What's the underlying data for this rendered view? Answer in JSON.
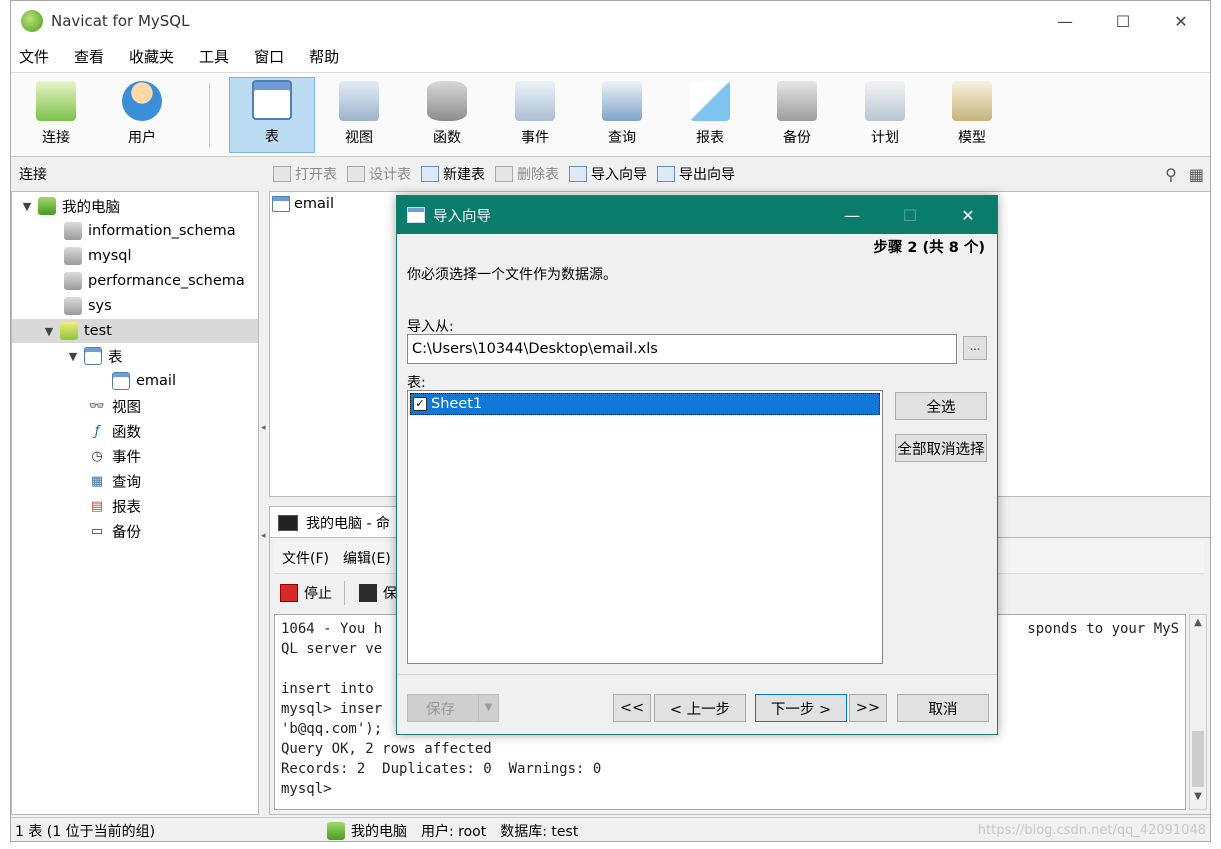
{
  "window": {
    "title": "Navicat for MySQL",
    "controls": {
      "minimize": "—",
      "maximize": "☐",
      "close": "✕"
    }
  },
  "menu": [
    "文件",
    "查看",
    "收藏夹",
    "工具",
    "窗口",
    "帮助"
  ],
  "toolbar": [
    {
      "label": "连接",
      "icon": "connection-icon"
    },
    {
      "label": "用户",
      "icon": "user-icon"
    },
    {
      "label": "表",
      "icon": "table-icon",
      "active": true
    },
    {
      "label": "视图",
      "icon": "view-icon"
    },
    {
      "label": "函数",
      "icon": "function-icon"
    },
    {
      "label": "事件",
      "icon": "event-icon"
    },
    {
      "label": "查询",
      "icon": "query-icon"
    },
    {
      "label": "报表",
      "icon": "report-icon"
    },
    {
      "label": "备份",
      "icon": "backup-icon"
    },
    {
      "label": "计划",
      "icon": "schedule-icon"
    },
    {
      "label": "模型",
      "icon": "model-icon"
    }
  ],
  "connections_label": "连接",
  "object_tools": [
    {
      "label": "打开表",
      "enabled": false
    },
    {
      "label": "设计表",
      "enabled": false
    },
    {
      "label": "新建表",
      "enabled": true
    },
    {
      "label": "删除表",
      "enabled": false
    },
    {
      "label": "导入向导",
      "enabled": true
    },
    {
      "label": "导出向导",
      "enabled": true
    }
  ],
  "right_tools": {
    "search": "⚲",
    "grid": "▦"
  },
  "tree": {
    "root": "我的电脑",
    "databases": [
      "information_schema",
      "mysql",
      "performance_schema",
      "sys",
      "test"
    ],
    "tables_group": "表",
    "tables": [
      "email"
    ],
    "other_groups": [
      "视图",
      "函数",
      "事件",
      "查询",
      "报表",
      "备份"
    ]
  },
  "object_pane": {
    "items": [
      "email"
    ]
  },
  "console": {
    "tab_label": "我的电脑 - 命",
    "menu": [
      "文件(F)",
      "编辑(E)"
    ],
    "tools": {
      "stop": "停止",
      "save": "保"
    },
    "lines": [
      "1064 - You h",
      "QL server ve",
      "",
      "insert into",
      "mysql> inser",
      "'b@qq.com');",
      "Query OK, 2 rows affected",
      "Records: 2  Duplicates: 0  Warnings: 0",
      "mysql>"
    ],
    "right_fragment": "sponds to your MyS"
  },
  "statusbar": {
    "left": "1 表 (1 位于当前的组)",
    "computer": "我的电脑",
    "user": "用户: root",
    "database": "数据库: test",
    "watermark": "https://blog.csdn.net/qq_42091048"
  },
  "dialog": {
    "title": "导入向导",
    "step": "步骤 2 (共 8 个)",
    "message": "你必须选择一个文件作为数据源。",
    "from_label": "导入从:",
    "path": "C:\\Users\\10344\\Desktop\\email.xls",
    "browse": "...",
    "table_label": "表:",
    "list": [
      {
        "name": "Sheet1",
        "checked": true
      }
    ],
    "select_all": "全选",
    "deselect_all": "全部取消选择",
    "save": "保存",
    "first": "<<",
    "prev": "< 上一步",
    "next": "下一步 >",
    "last": ">>",
    "cancel": "取消"
  }
}
